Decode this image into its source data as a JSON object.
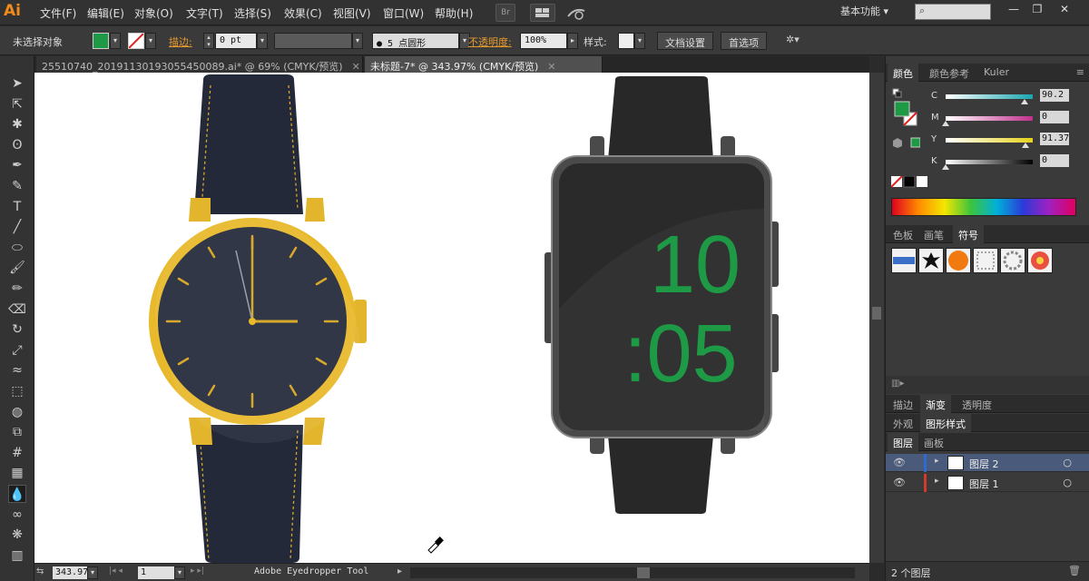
{
  "app": {
    "logo": "Ai"
  },
  "menu": [
    "文件(F)",
    "编辑(E)",
    "对象(O)",
    "文字(T)",
    "选择(S)",
    "效果(C)",
    "视图(V)",
    "窗口(W)",
    "帮助(H)"
  ],
  "menu_extra": {
    "br": "Br"
  },
  "workspace": {
    "label": "基本功能",
    "arrow": "▾"
  },
  "window_buttons": [
    "—",
    "❐",
    "✕"
  ],
  "control_bar": {
    "selection": "未选择对象",
    "stroke_label": "描边:",
    "stroke_value": "0 pt",
    "brush_value": "● 5 点圆形",
    "opacity_label": "不透明度:",
    "opacity_value": "100%",
    "style_label": "样式:",
    "doc_setup": "文档设置",
    "preferences": "首选项",
    "fill_color": "#1e9a46"
  },
  "doc_tabs": [
    {
      "label": "25510740_20191130193055450089.ai* @ 69% (CMYK/预览)",
      "active": false,
      "close": "✕"
    },
    {
      "label": "未标题-7* @ 343.97% (CMYK/预览)",
      "active": true,
      "close": "✕"
    }
  ],
  "tools": [
    "selection-icon",
    "direct-selection-icon",
    "magic-wand-icon",
    "lasso-icon",
    "pen-icon",
    "curvature-icon",
    "type-icon",
    "line-icon",
    "ellipse-icon",
    "paintbrush-icon",
    "pencil-icon",
    "eraser-icon",
    "rotate-icon",
    "scale-icon",
    "warp-icon",
    "free-transform-icon",
    "shape-builder-icon",
    "perspective-icon",
    "mesh-icon",
    "gradient-icon",
    "eyedropper-icon",
    "blend-icon",
    "symbol-sprayer-icon",
    "graph-icon"
  ],
  "tool_glyphs": [
    "➤",
    "⇱",
    "✱",
    "ʘ",
    "✒",
    "✎",
    "T",
    "╱",
    "⬭",
    "🖌",
    "✏",
    "⌫",
    "↻",
    "⤢",
    "≈",
    "⬚",
    "◍",
    "⧉",
    "#",
    "▦",
    "💧",
    "∞",
    "❋",
    "▥"
  ],
  "selected_tool": 20,
  "watch_time": {
    "hour": "10",
    "minute": ":05"
  },
  "status": {
    "zoom": "343.97",
    "artboard": "1",
    "tool": "Adobe Eyedropper Tool"
  },
  "color_panel": {
    "tabs": [
      "颜色",
      "颜色参考",
      "Kuler"
    ],
    "sliders": [
      {
        "name": "C",
        "value": "90.2",
        "fraction": 0.902,
        "color": "#1aa6b0"
      },
      {
        "name": "M",
        "value": "0",
        "fraction": 0.0,
        "color": "#c0308c"
      },
      {
        "name": "Y",
        "value": "91.37",
        "fraction": 0.9137,
        "color": "#e6d21a"
      },
      {
        "name": "K",
        "value": "0",
        "fraction": 0.0,
        "color": "#000000"
      }
    ]
  },
  "symbols_panel": {
    "tabs": [
      "色板",
      "画笔",
      "符号"
    ]
  },
  "misc_tabs": {
    "row1": [
      "描边",
      "渐变",
      "透明度"
    ],
    "row2": [
      "外观",
      "图形样式"
    ],
    "row3": [
      "图层",
      "画板"
    ]
  },
  "layers": [
    {
      "name": "图层 2",
      "color": "#2d6bd1",
      "selected": true
    },
    {
      "name": "图层 1",
      "color": "#d13b2d",
      "selected": false
    }
  ],
  "layers_footer": "2 个图层"
}
